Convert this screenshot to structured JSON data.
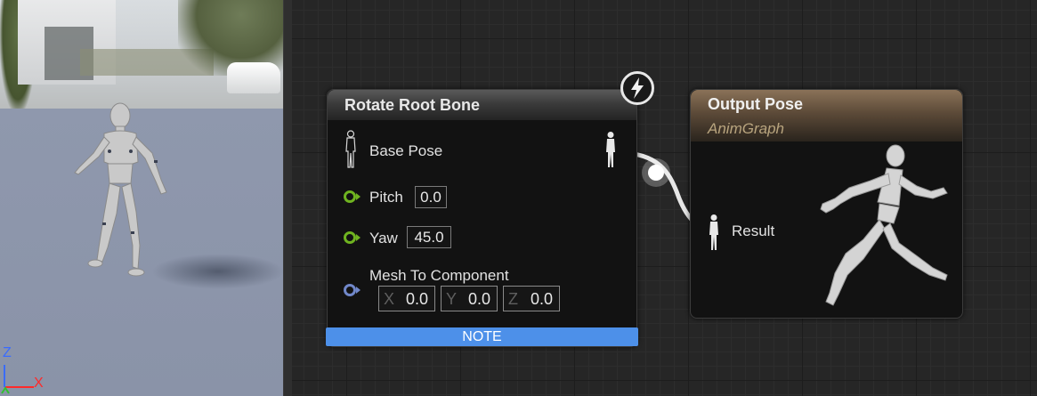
{
  "viewport": {
    "axis_z": "Z",
    "axis_x": "X"
  },
  "rotate_root_bone": {
    "title": "Rotate Root Bone",
    "base_pose_label": "Base Pose",
    "pitch_label": "Pitch",
    "pitch_value": "0.0",
    "yaw_label": "Yaw",
    "yaw_value": "45.0",
    "mesh_label": "Mesh To Component",
    "mesh_x_axis": "X",
    "mesh_x_value": "0.0",
    "mesh_y_axis": "Y",
    "mesh_y_value": "0.0",
    "mesh_z_axis": "Z",
    "mesh_z_value": "0.0",
    "note_label": "NOTE"
  },
  "output_pose": {
    "title": "Output Pose",
    "subtitle": "AnimGraph",
    "result_label": "Result"
  },
  "colors": {
    "float_pin": "#6fb320",
    "vector_pin": "#7087c9",
    "note_bar": "#4d90e9",
    "output_header": "#8a7258"
  },
  "icons": [
    "pose-pin-icon",
    "lightning-bolt-icon",
    "running-mannequin-icon"
  ]
}
